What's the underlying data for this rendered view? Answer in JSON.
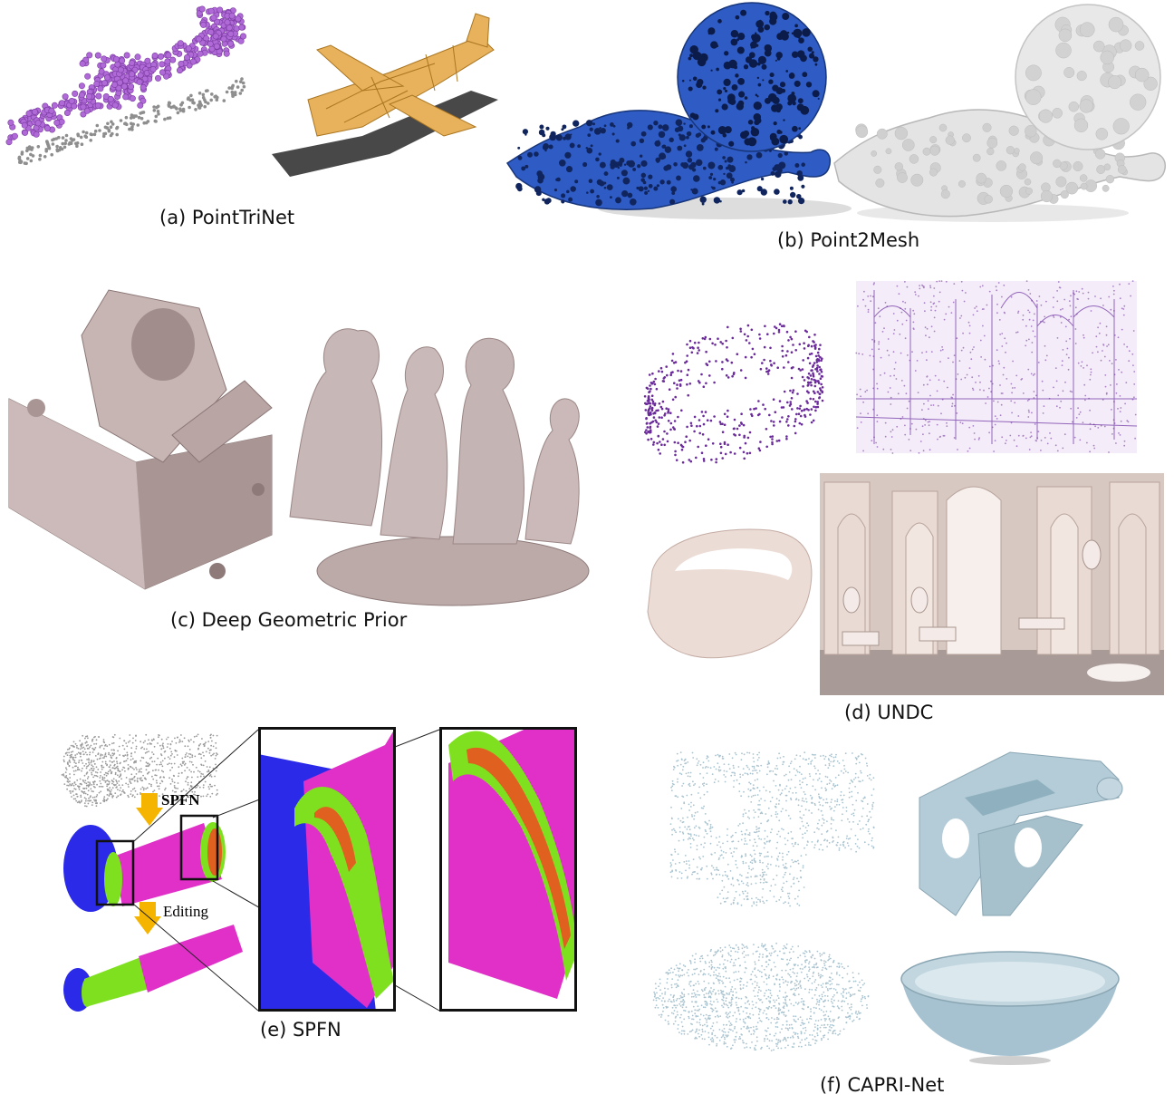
{
  "captions": {
    "a": "(a) PointTriNet",
    "b": "(b) Point2Mesh",
    "c": "(c) Deep Geometric Prior",
    "d": "(d) UNDC",
    "e": "(e) SPFN",
    "f": "(f) CAPRI-Net"
  },
  "spfn_labels": {
    "arrow1": "SPFN",
    "arrow2": "Editing"
  },
  "colors": {
    "points_purple": "#b06ad8",
    "plane_orange": "#e8b25c",
    "mesh_blue": "#2f5cc4",
    "mesh_gray": "#e4e4e4",
    "dgp_pink": "#c9b7b6",
    "undc_purple": "#6a2a9a",
    "undc_skin": "#ecdcd6",
    "spfn_blue": "#2a2ae8",
    "spfn_magenta": "#e030c8",
    "spfn_green": "#7fe020",
    "spfn_orange": "#e06020",
    "arrow_yellow": "#f5b400",
    "capri_blue": "#b4ccd8"
  }
}
